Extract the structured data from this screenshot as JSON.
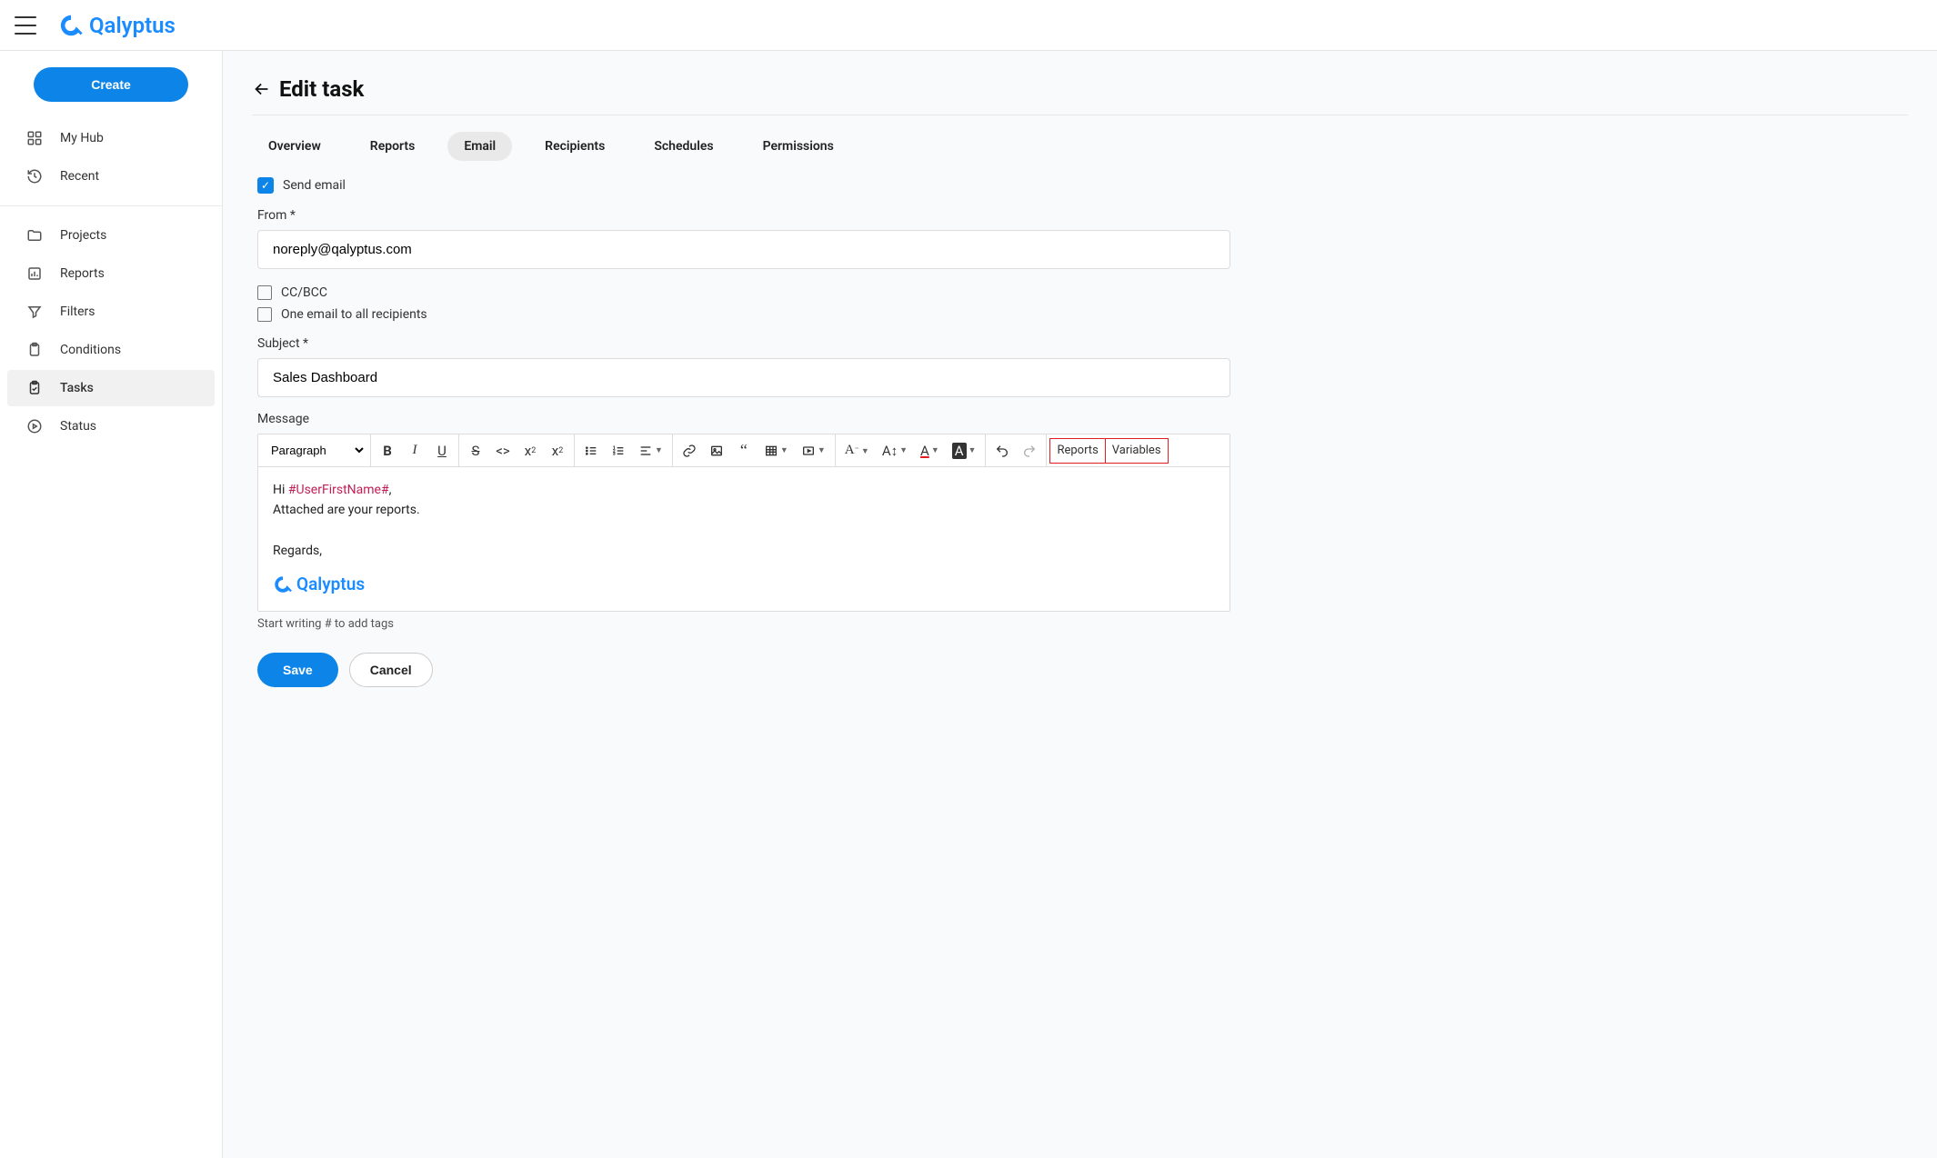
{
  "app": {
    "brand": "Qalyptus"
  },
  "sidebar": {
    "create_label": "Create",
    "items": [
      {
        "label": "My Hub",
        "icon": "grid"
      },
      {
        "label": "Recent",
        "icon": "history"
      },
      {
        "label": "Projects",
        "icon": "folder"
      },
      {
        "label": "Reports",
        "icon": "barchart"
      },
      {
        "label": "Filters",
        "icon": "filter"
      },
      {
        "label": "Conditions",
        "icon": "clipboard"
      },
      {
        "label": "Tasks",
        "icon": "checklist",
        "active": true
      },
      {
        "label": "Status",
        "icon": "play"
      }
    ]
  },
  "page": {
    "title": "Edit task",
    "tabs": [
      "Overview",
      "Reports",
      "Email",
      "Recipients",
      "Schedules",
      "Permissions"
    ],
    "active_tab": "Email"
  },
  "form": {
    "send_email_label": "Send email",
    "from_label": "From *",
    "from_value": "noreply@qalyptus.com",
    "ccbcc_label": "CC/BCC",
    "one_email_label": "One email to all recipients",
    "subject_label": "Subject *",
    "subject_value": "Sales Dashboard",
    "message_label": "Message",
    "paragraph_label": "Paragraph",
    "message_body": {
      "greeting_prefix": "Hi ",
      "variable": "#UserFirstName#",
      "greeting_suffix": ",",
      "line2": "Attached are your reports.",
      "signoff": "Regards,",
      "logo_text": "Qalyptus"
    },
    "hint": "Start writing # to add tags",
    "toolbar_right": {
      "reports": "Reports",
      "variables": "Variables"
    }
  },
  "actions": {
    "save": "Save",
    "cancel": "Cancel"
  }
}
